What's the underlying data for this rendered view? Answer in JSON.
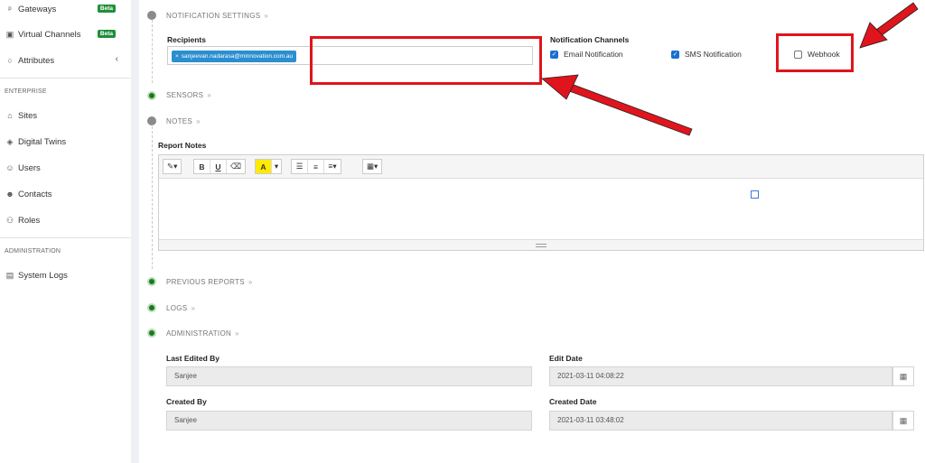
{
  "sidebar": {
    "items_top": [
      {
        "label": "Gateways",
        "icon": "gateway-icon",
        "badge": "Beta"
      },
      {
        "label": "Virtual Channels",
        "icon": "virtual-channel-icon",
        "badge": "Beta"
      },
      {
        "label": "Attributes",
        "icon": "circle-icon",
        "chevron": "‹"
      }
    ],
    "enterprise_heading": "ENTERPRISE",
    "enterprise_items": [
      {
        "label": "Sites",
        "icon": "sites-icon"
      },
      {
        "label": "Digital Twins",
        "icon": "digital-twin-icon"
      },
      {
        "label": "Users",
        "icon": "user-icon"
      },
      {
        "label": "Contacts",
        "icon": "contacts-icon"
      },
      {
        "label": "Roles",
        "icon": "roles-icon"
      }
    ],
    "administration_heading": "ADMINISTRATION",
    "administration_items": [
      {
        "label": "System Logs",
        "icon": "clipboard-icon"
      }
    ]
  },
  "sections": {
    "notification_settings": "NOTIFICATION SETTINGS",
    "sensors": "SENSORS",
    "notes": "NOTES",
    "previous_reports": "PREVIOUS REPORTS",
    "logs": "LOGS",
    "administration": "ADMINISTRATION",
    "chevron": "»"
  },
  "notification": {
    "recipients_label": "Recipients",
    "recipient_tag": "sanjeevan.nadarasa@minnovation.com.au",
    "tag_remove": "×",
    "channels_label": "Notification Channels",
    "email": {
      "label": "Email Notification",
      "checked": true
    },
    "sms": {
      "label": "SMS Notification",
      "checked": true
    },
    "webhook": {
      "label": "Webhook",
      "checked": false
    }
  },
  "notes": {
    "report_notes_label": "Report Notes",
    "toolbar": {
      "magic": "✎▾",
      "bold": "B",
      "underline": "U",
      "eraser": "⌫",
      "color": "A",
      "color_caret": "▾",
      "ul": "☰",
      "ol": "≡",
      "align": "≡▾",
      "table": "▦▾"
    }
  },
  "admin": {
    "last_edited_by_label": "Last Edited By",
    "last_edited_by": "Sanjee",
    "edit_date_label": "Edit Date",
    "edit_date": "2021-03-11 04:08:22",
    "created_by_label": "Created By",
    "created_by": "Sanjee",
    "created_date_label": "Created Date",
    "created_date": "2021-03-11 03:48:02"
  },
  "colors": {
    "accent_red": "#e0141c",
    "beta_badge": "#1f8f3a",
    "tag_blue": "#2a8ecf",
    "status_green": "#1a7a1a"
  }
}
